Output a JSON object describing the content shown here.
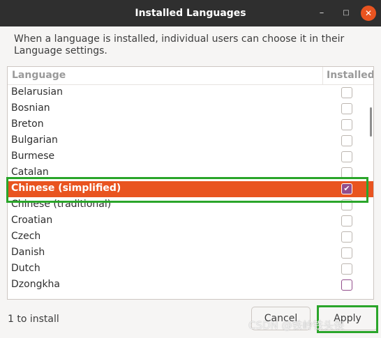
{
  "window": {
    "title": "Installed Languages",
    "controls": {
      "minimize": "–",
      "maximize": "□",
      "close": "✕"
    }
  },
  "description": "When a language is installed, individual users can choose it in their Language settings.",
  "table": {
    "columns": [
      "Language",
      "Installed"
    ],
    "rows": [
      {
        "name": "Belarusian",
        "installed": false
      },
      {
        "name": "Bosnian",
        "installed": false
      },
      {
        "name": "Breton",
        "installed": false
      },
      {
        "name": "Bulgarian",
        "installed": false
      },
      {
        "name": "Burmese",
        "installed": false
      },
      {
        "name": "Catalan",
        "installed": false
      },
      {
        "name": "Chinese (simplified)",
        "installed": true,
        "selected": true
      },
      {
        "name": "Chinese (traditional)",
        "installed": false
      },
      {
        "name": "Croatian",
        "installed": false
      },
      {
        "name": "Czech",
        "installed": false
      },
      {
        "name": "Danish",
        "installed": false
      },
      {
        "name": "Dutch",
        "installed": false
      },
      {
        "name": "Dzongkha",
        "installed": false
      }
    ]
  },
  "status": "1 to install",
  "buttons": {
    "cancel": "Cancel",
    "apply": "Apply"
  },
  "watermark": "CSDN @铁岭铁头侠",
  "colors": {
    "accent": "#e95420",
    "check": "#924d8b",
    "titlebar": "#2f2f2f",
    "highlight": "#2aa52a"
  }
}
